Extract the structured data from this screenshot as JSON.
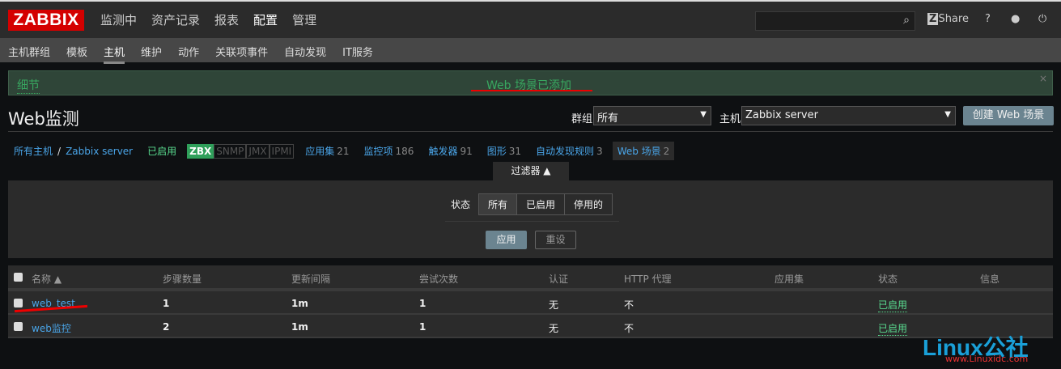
{
  "header": {
    "logo": "ZABBIX",
    "nav": [
      "监测中",
      "资产记录",
      "报表",
      "配置",
      "管理"
    ],
    "active_nav": "配置",
    "search_placeholder": "",
    "share": "Share",
    "help": "?"
  },
  "subnav": {
    "items": [
      "主机群组",
      "模板",
      "主机",
      "维护",
      "动作",
      "关联项事件",
      "自动发现",
      "IT服务"
    ],
    "active": "主机"
  },
  "message": {
    "details": "细节",
    "text": "Web 场景已添加",
    "close": "×"
  },
  "page": {
    "title": "Web监测",
    "group_label": "群组",
    "group_value": "所有",
    "host_label": "主机",
    "host_value": "Zabbix server",
    "create_button": "创建 Web 场景"
  },
  "breadcrumb": {
    "all_hosts": "所有主机",
    "sep": "/",
    "host": "Zabbix server",
    "status": "已启用",
    "tags": [
      "ZBX",
      "SNMP",
      "JMX",
      "IPMI"
    ],
    "links": [
      {
        "label": "应用集",
        "count": "21"
      },
      {
        "label": "监控项",
        "count": "186"
      },
      {
        "label": "触发器",
        "count": "91"
      },
      {
        "label": "图形",
        "count": "31"
      },
      {
        "label": "自动发现规则",
        "count": "3"
      },
      {
        "label": "Web 场景",
        "count": "2"
      }
    ]
  },
  "filter": {
    "tab": "过滤器 ▲",
    "status_label": "状态",
    "options": [
      "所有",
      "已启用",
      "停用的"
    ],
    "apply": "应用",
    "reset": "重设"
  },
  "table": {
    "columns": [
      "名称 ▲",
      "步骤数量",
      "更新间隔",
      "尝试次数",
      "认证",
      "HTTP 代理",
      "应用集",
      "状态",
      "信息"
    ],
    "rows": [
      {
        "name": "web_test",
        "steps": "1",
        "interval": "1m",
        "attempts": "1",
        "auth": "无",
        "proxy": "不",
        "apps": "",
        "status": "已启用",
        "info": ""
      },
      {
        "name": "web监控",
        "steps": "2",
        "interval": "1m",
        "attempts": "1",
        "auth": "无",
        "proxy": "不",
        "apps": "",
        "status": "已启用",
        "info": ""
      }
    ]
  },
  "watermark": {
    "logo": "Linux公社",
    "url": "www.Linuxidc.com"
  }
}
